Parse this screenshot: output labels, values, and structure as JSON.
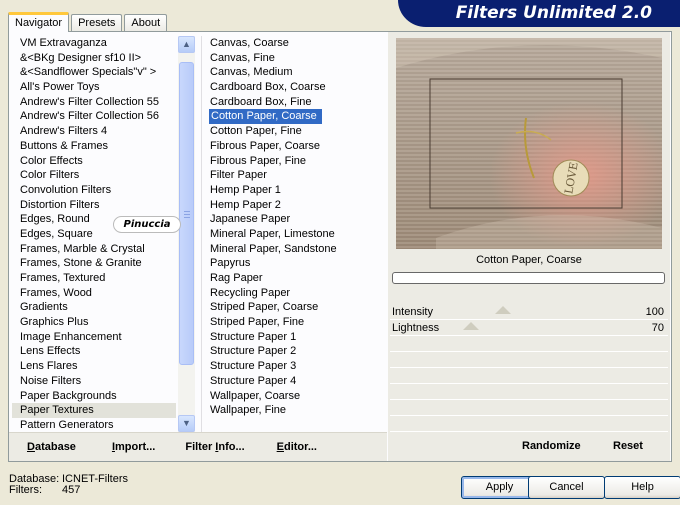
{
  "tabs": [
    {
      "label": "Navigator",
      "active": true
    },
    {
      "label": "Presets",
      "active": false
    },
    {
      "label": "About",
      "active": false
    }
  ],
  "app_title": "Filters Unlimited 2.0",
  "categories": [
    "VM Extravaganza",
    "&<BKg Designer sf10 II>",
    "&<Sandflower Specials\"v\" >",
    "All's Power Toys",
    "Andrew's Filter Collection 55",
    "Andrew's Filter Collection 56",
    "Andrew's Filters 4",
    "Buttons & Frames",
    "Color Effects",
    "Color Filters",
    "Convolution Filters",
    "Distortion Filters",
    "Edges, Round",
    "Edges, Square",
    "Frames, Marble & Crystal",
    "Frames, Stone & Granite",
    "Frames, Textured",
    "Frames, Wood",
    "Gradients",
    "Graphics Plus",
    "Image Enhancement",
    "Lens Effects",
    "Lens Flares",
    "Noise Filters",
    "Paper Backgrounds",
    "Paper Textures",
    "Pattern Generators"
  ],
  "selected_category": "Paper Textures",
  "filters": [
    "Canvas, Coarse",
    "Canvas, Fine",
    "Canvas, Medium",
    "Cardboard Box, Coarse",
    "Cardboard Box, Fine",
    "Cotton Paper, Coarse",
    "Cotton Paper, Fine",
    "Fibrous Paper, Coarse",
    "Fibrous Paper, Fine",
    "Filter Paper",
    "Hemp Paper 1",
    "Hemp Paper 2",
    "Japanese Paper",
    "Mineral Paper, Limestone",
    "Mineral Paper, Sandstone",
    "Papyrus",
    "Rag Paper",
    "Recycling Paper",
    "Striped Paper, Coarse",
    "Striped Paper, Fine",
    "Structure Paper 1",
    "Structure Paper 2",
    "Structure Paper 3",
    "Structure Paper 4",
    "Wallpaper, Coarse",
    "Wallpaper, Fine"
  ],
  "selected_filter": "Cotton Paper, Coarse",
  "watermark": "Pinuccia",
  "preview_caption": "Cotton Paper, Coarse",
  "preview_text": "LOVE",
  "params": [
    {
      "name": "Intensity",
      "value": "100",
      "level": 0.39
    },
    {
      "name": "Lightness",
      "value": "70",
      "level": 0.27
    }
  ],
  "bottom_bar": {
    "database": {
      "u": "D",
      "rest": "atabase"
    },
    "import": {
      "pre": "",
      "u": "I",
      "rest": "mport..."
    },
    "filter_info": {
      "pre": "Filter ",
      "u": "I",
      "rest": "nfo..."
    },
    "editor": {
      "pre": "",
      "u": "E",
      "rest": "ditor..."
    }
  },
  "randomize_label": "Randomize",
  "reset_label": "Reset",
  "status": {
    "database_label": "Database:",
    "database_value": "ICNET-Filters",
    "filters_label": "Filters:",
    "filters_value": "457"
  },
  "buttons": {
    "apply": "Apply",
    "cancel": "Cancel",
    "help": "Help"
  },
  "colors": {
    "accent": "#316ac5",
    "banner": "#0a1f70",
    "tab_highlight": "#ffc83c"
  }
}
